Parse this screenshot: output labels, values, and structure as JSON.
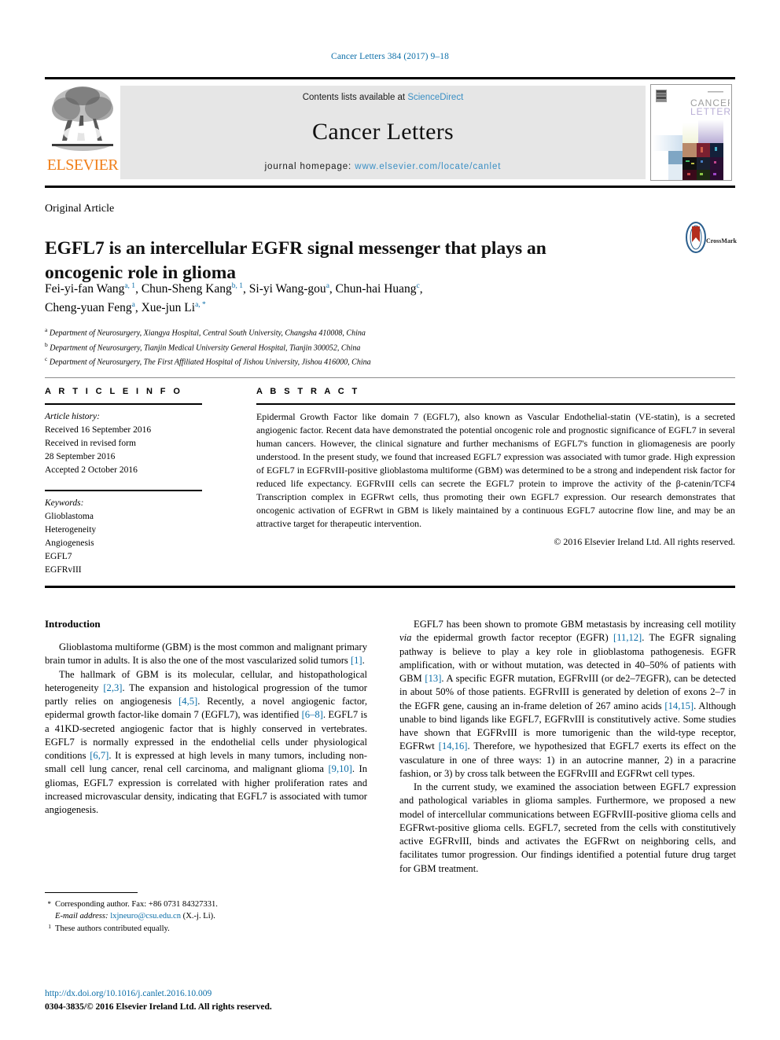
{
  "running_head": "Cancer Letters 384 (2017) 9–18",
  "masthead": {
    "contents_prefix": "Contents lists available at ",
    "contents_link": "ScienceDirect",
    "journal_name": "Cancer Letters",
    "homepage_prefix": "journal homepage: ",
    "homepage_url": "www.elsevier.com/locate/canlet",
    "publisher": "ELSEVIER",
    "cover_title_line1": "CANCER",
    "cover_title_line2": "LETTERS"
  },
  "article": {
    "type": "Original Article",
    "title": "EGFL7 is an intercellular EGFR signal messenger that plays an oncogenic role in glioma",
    "crossmark_label": "CrossMark",
    "authors_line1_parts": [
      {
        "name": "Fei-yi-fan Wang",
        "sup": "a, 1",
        "sep": ", "
      },
      {
        "name": "Chun-Sheng Kang",
        "sup": "b, 1",
        "sep": ", "
      },
      {
        "name": "Si-yi Wang-gou",
        "sup": "a",
        "sep": ", "
      },
      {
        "name": "Chun-hai Huang",
        "sup": "c",
        "sep": ","
      }
    ],
    "authors_line2_parts": [
      {
        "name": "Cheng-yuan Feng",
        "sup": "a",
        "sep": ", "
      },
      {
        "name": "Xue-jun Li",
        "sup": "a, *",
        "sep": ""
      }
    ],
    "affiliations": [
      {
        "mark": "a",
        "text": "Department of Neurosurgery, Xiangya Hospital, Central South University, Changsha 410008, China"
      },
      {
        "mark": "b",
        "text": "Department of Neurosurgery, Tianjin Medical University General Hospital, Tianjin 300052, China"
      },
      {
        "mark": "c",
        "text": "Department of Neurosurgery, The First Affiliated Hospital of Jishou University, Jishou 416000, China"
      }
    ]
  },
  "info": {
    "heading": "A R T I C L E    I N F O",
    "history_label": "Article history:",
    "history_lines": [
      "Received 16 September 2016",
      "Received in revised form",
      "28 September 2016",
      "Accepted 2 October 2016"
    ],
    "keywords_label": "Keywords:",
    "keywords": [
      "Glioblastoma",
      "Heterogeneity",
      "Angiogenesis",
      "EGFL7",
      "EGFRvIII"
    ]
  },
  "abstract": {
    "heading": "A B S T R A C T",
    "text": "Epidermal Growth Factor like domain 7 (EGFL7), also known as Vascular Endothelial-statin (VE-statin), is a secreted angiogenic factor. Recent data have demonstrated the potential oncogenic role and prognostic significance of EGFL7 in several human cancers. However, the clinical signature and further mechanisms of EGFL7's function in gliomagenesis are poorly understood. In the present study, we found that increased EGFL7 expression was associated with tumor grade. High expression of EGFL7 in EGFRvIII-positive glioblastoma multiforme (GBM) was determined to be a strong and independent risk factor for reduced life expectancy. EGFRvIII cells can secrete the EGFL7 protein to improve the activity of the β-catenin/TCF4 Transcription complex in EGFRwt cells, thus promoting their own EGFL7 expression. Our research demonstrates that oncogenic activation of EGFRwt in GBM is likely maintained by a continuous EGFL7 autocrine flow line, and may be an attractive target for therapeutic intervention.",
    "copyright": "© 2016 Elsevier Ireland Ltd. All rights reserved."
  },
  "introduction": {
    "heading": "Introduction",
    "left_paragraphs": [
      "Glioblastoma multiforme (GBM) is the most common and malignant primary brain tumor in adults. It is also the one of the most vascularized solid tumors [1].",
      "The hallmark of GBM is its molecular, cellular, and histopathological heterogeneity [2,3]. The expansion and histological progression of the tumor partly relies on angiogenesis [4,5]. Recently, a novel angiogenic factor, epidermal growth factor-like domain 7 (EGFL7), was identified [6–8]. EGFL7 is a 41KD-secreted angiogenic factor that is highly conserved in vertebrates. EGFL7 is normally expressed in the endothelial cells under physiological conditions [6,7]. It is expressed at high levels in many tumors, including non-small cell lung cancer, renal cell carcinoma, and malignant glioma [9,10]. In gliomas, EGFL7 expression is correlated with higher proliferation rates and increased microvascular density, indicating that EGFL7 is associated with tumor angiogenesis."
    ],
    "right_paragraphs": [
      "EGFL7 has been shown to promote GBM metastasis by increasing cell motility via the epidermal growth factor receptor (EGFR) [11,12]. The EGFR signaling pathway is believe to play a key role in glioblastoma pathogenesis. EGFR amplification, with or without mutation, was detected in 40–50% of patients with GBM [13]. A specific EGFR mutation, EGFRvIII (or de2–7EGFR), can be detected in about 50% of those patients. EGFRvIII is generated by deletion of exons 2–7 in the EGFR gene, causing an in-frame deletion of 267 amino acids [14,15]. Although unable to bind ligands like EGFL7, EGFRvIII is constitutively active. Some studies have shown that EGFRvIII is more tumorigenic than the wild-type receptor, EGFRwt [14,16]. Therefore, we hypothesized that EGFL7 exerts its effect on the vasculature in one of three ways: 1) in an autocrine manner, 2) in a paracrine fashion, or 3) by cross talk between the EGFRvIII and EGFRwt cell types.",
      "In the current study, we examined the association between EGFL7 expression and pathological variables in glioma samples. Furthermore, we proposed a new model of intercellular communications between EGFRvIII-positive glioma cells and EGFRwt-positive glioma cells. EGFL7, secreted from the cells with constitutively active EGFRvIII, binds and activates the EGFRwt on neighboring cells, and facilitates tumor progression. Our findings identified a potential future drug target for GBM treatment."
    ]
  },
  "footnotes": {
    "corresponding_mark": "*",
    "corresponding_text": "Corresponding author. Fax: +86 0731 84327331.",
    "email_label": "E-mail address:",
    "email": "lxjneuro@csu.edu.cn",
    "email_suffix": "(X.-j. Li).",
    "equal_mark": "1",
    "equal_text": "These authors contributed equally."
  },
  "doi": {
    "url": "http://dx.doi.org/10.1016/j.canlet.2016.10.009",
    "copyright": "0304-3835/© 2016 Elsevier Ireland Ltd. All rights reserved."
  },
  "colors": {
    "link": "#0b6ea8",
    "masthead_link": "#3a8fc4",
    "elsevier_orange": "#f07f1a",
    "masthead_bg": "#e6e6e6"
  }
}
